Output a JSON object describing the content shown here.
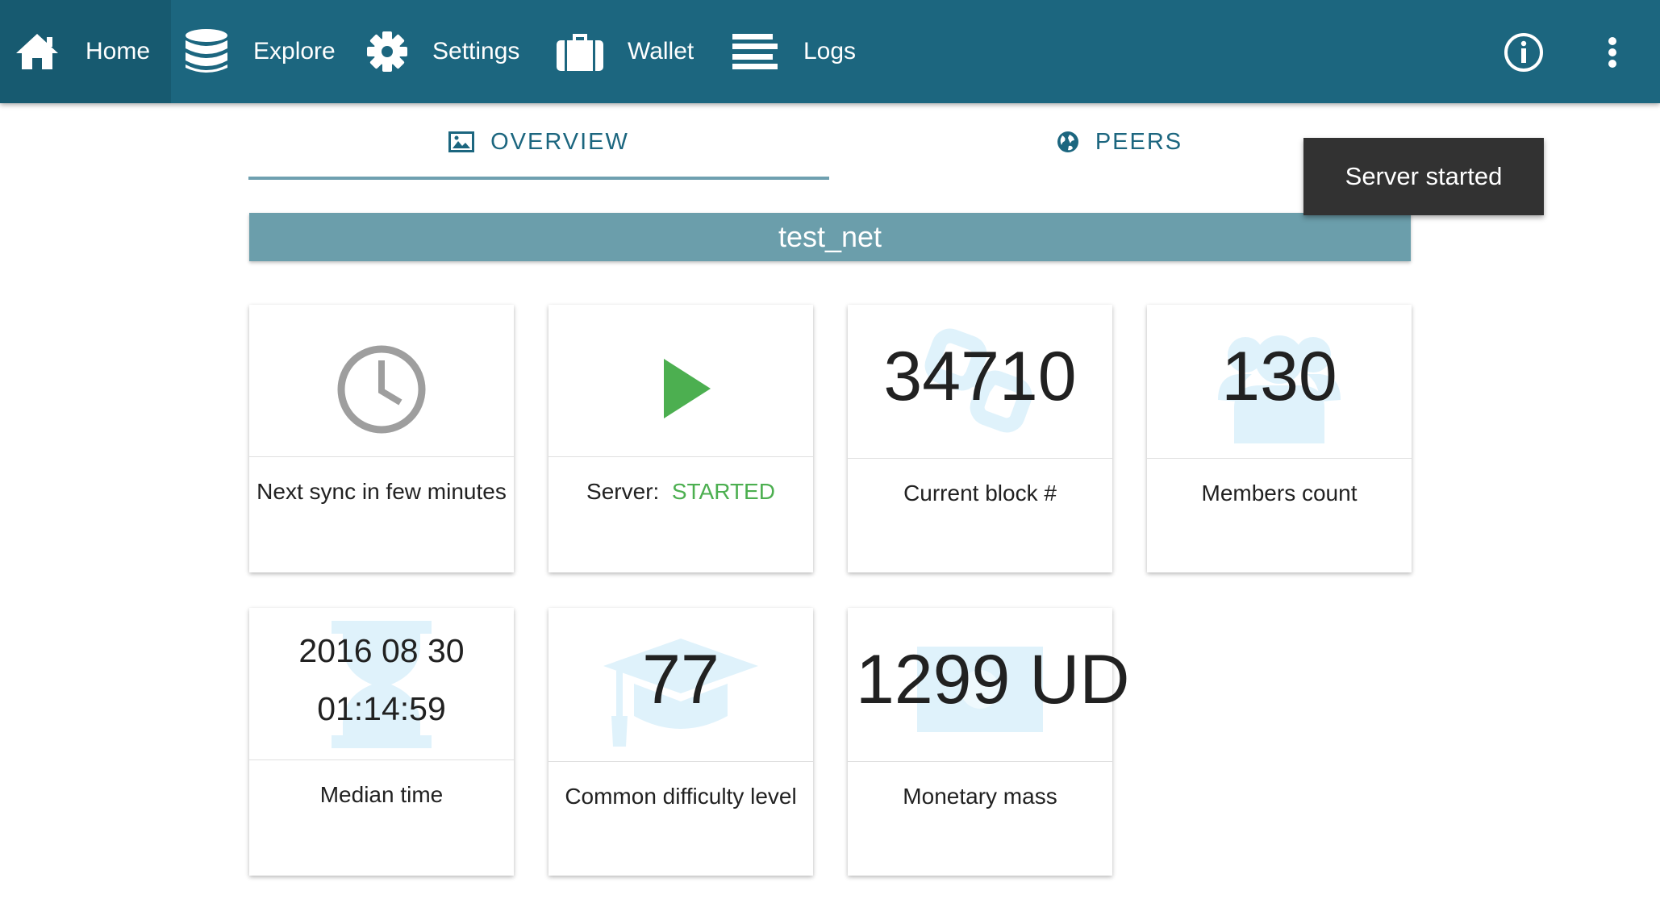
{
  "nav": {
    "items": [
      {
        "label": "Home",
        "icon": "home-icon"
      },
      {
        "label": "Explore",
        "icon": "database-icon"
      },
      {
        "label": "Settings",
        "icon": "gear-icon"
      },
      {
        "label": "Wallet",
        "icon": "briefcase-icon"
      },
      {
        "label": "Logs",
        "icon": "lines-icon"
      }
    ],
    "active": "Home",
    "info_icon": "info-icon",
    "more_icon": "more-vert-icon"
  },
  "tabs": [
    {
      "label": "OVERVIEW",
      "icon": "image-icon",
      "active": true
    },
    {
      "label": "PEERS",
      "icon": "globe-icon",
      "active": false
    }
  ],
  "banner": {
    "network": "test_net"
  },
  "toast": {
    "message": "Server started"
  },
  "cards": {
    "sync": {
      "label": "Next sync in few minutes",
      "icon": "clock-icon"
    },
    "server": {
      "label_prefix": "Server:",
      "status": "STARTED",
      "icon": "play-icon"
    },
    "block": {
      "value": "34710",
      "label": "Current block #",
      "bg_icon": "block-icon"
    },
    "members": {
      "value": "130",
      "label": "Members count",
      "bg_icon": "group-icon"
    },
    "median": {
      "date": "2016 08 30",
      "time": "01:14:59",
      "label": "Median time",
      "bg_icon": "hourglass-icon"
    },
    "difficulty": {
      "value": "77",
      "label": "Common difficulty level",
      "bg_icon": "graduation-cap-icon"
    },
    "monetary": {
      "value": "1299 UD",
      "label": "Monetary mass",
      "bg_icon": "money-icon"
    }
  },
  "colors": {
    "primary": "#1c667f",
    "banner": "#6b9eab",
    "toast": "#323232",
    "status_started": "#4caf50",
    "bg_icon": "#dff2fb"
  }
}
